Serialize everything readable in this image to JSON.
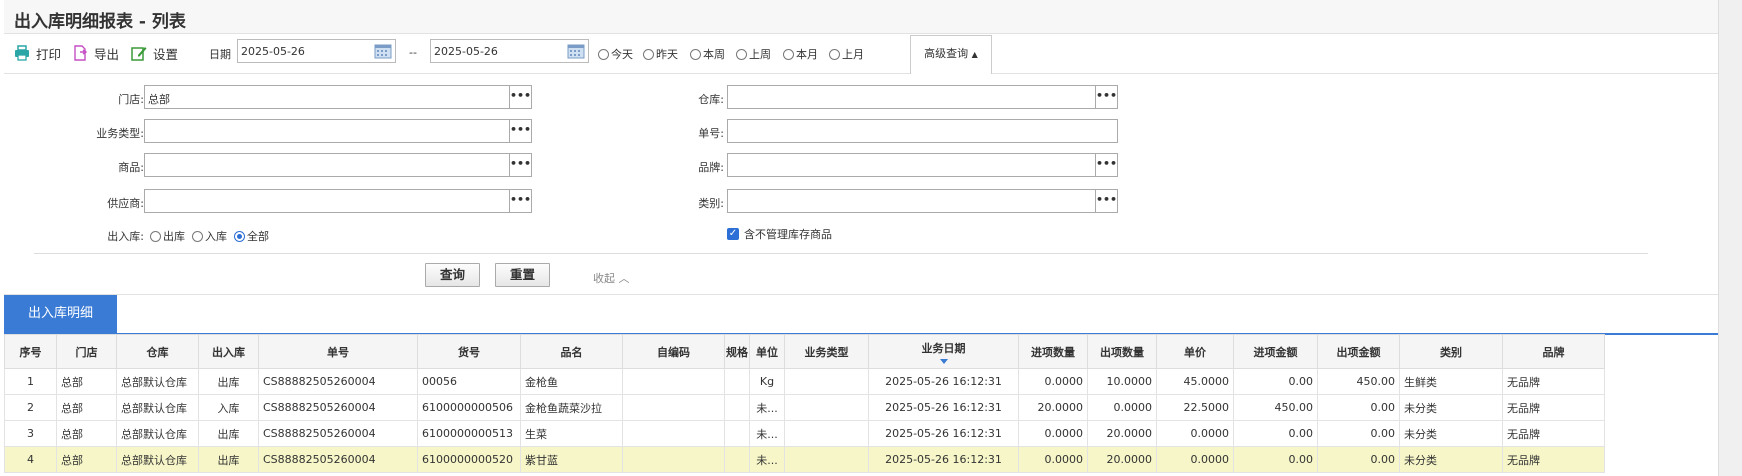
{
  "title": "出入库明细报表 - 列表",
  "toolbar": {
    "print": "打印",
    "export": "导出",
    "settings": "设置",
    "date_label": "日期",
    "date_from": "2025-05-26",
    "date_sep": "--",
    "date_to": "2025-05-26",
    "quick": [
      "今天",
      "昨天",
      "本周",
      "上周",
      "本月",
      "上月"
    ],
    "advanced": "高级查询"
  },
  "filters": {
    "store_label": "门店:",
    "store_value": "总部",
    "biztype_label": "业务类型:",
    "product_label": "商品:",
    "supplier_label": "供应商:",
    "inout_label": "出入库:",
    "inout_options": [
      "出库",
      "入库",
      "全部"
    ],
    "inout_selected": "全部",
    "warehouse_label": "仓库:",
    "docno_label": "单号:",
    "brand_label": "品牌:",
    "category_label": "类别:",
    "include_unmanaged": "含不管理库存商品",
    "query": "查询",
    "reset": "重置",
    "collapse": "收起 ︿"
  },
  "grid": {
    "tab": "出入库明细",
    "columns": [
      "序号",
      "门店",
      "仓库",
      "出入库",
      "单号",
      "货号",
      "品名",
      "自编码",
      "规格",
      "单位",
      "业务类型",
      "业务日期",
      "进项数量",
      "出项数量",
      "单价",
      "进项金额",
      "出项金额",
      "类别",
      "品牌"
    ],
    "rows": [
      [
        "1",
        "总部",
        "总部默认仓库",
        "出库",
        "CS88882505260004",
        "00056",
        "金枪鱼",
        "",
        "",
        "Kg",
        "",
        "2025-05-26 16:12:31",
        "0.0000",
        "10.0000",
        "45.0000",
        "0.00",
        "450.00",
        "生鲜类",
        "无品牌"
      ],
      [
        "2",
        "总部",
        "总部默认仓库",
        "入库",
        "CS88882505260004",
        "6100000000506",
        "金枪鱼蔬菜沙拉",
        "",
        "",
        "未...",
        "",
        "2025-05-26 16:12:31",
        "20.0000",
        "0.0000",
        "22.5000",
        "450.00",
        "0.00",
        "未分类",
        "无品牌"
      ],
      [
        "3",
        "总部",
        "总部默认仓库",
        "出库",
        "CS88882505260004",
        "6100000000513",
        "生菜",
        "",
        "",
        "未...",
        "",
        "2025-05-26 16:12:31",
        "0.0000",
        "20.0000",
        "0.0000",
        "0.00",
        "0.00",
        "未分类",
        "无品牌"
      ],
      [
        "4",
        "总部",
        "总部默认仓库",
        "出库",
        "CS88882505260004",
        "6100000000520",
        "紫甘蓝",
        "",
        "",
        "未...",
        "",
        "2025-05-26 16:12:31",
        "0.0000",
        "20.0000",
        "0.0000",
        "0.00",
        "0.00",
        "未分类",
        "无品牌"
      ]
    ]
  }
}
